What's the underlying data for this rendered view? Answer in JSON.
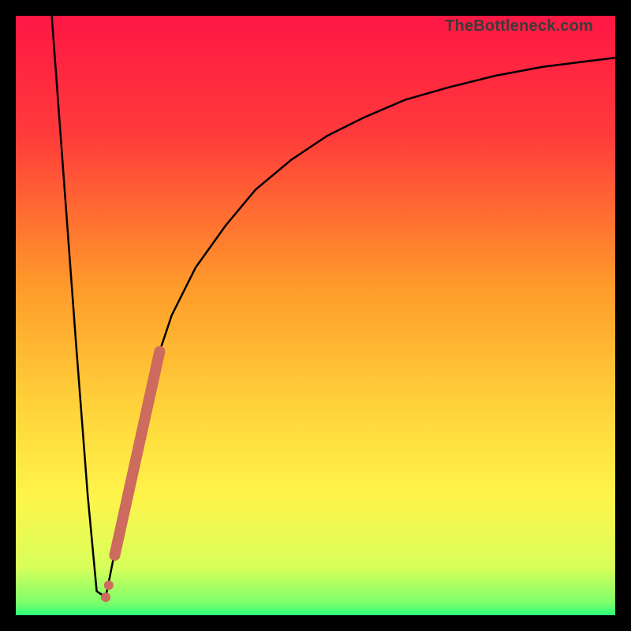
{
  "watermark": "TheBottleneck.com",
  "gradient_stops": [
    {
      "pct": 0,
      "color": "#ff1744"
    },
    {
      "pct": 20,
      "color": "#ff3b3b"
    },
    {
      "pct": 45,
      "color": "#ff9a2a"
    },
    {
      "pct": 65,
      "color": "#ffd23a"
    },
    {
      "pct": 80,
      "color": "#fff44a"
    },
    {
      "pct": 92,
      "color": "#d8ff5a"
    },
    {
      "pct": 98,
      "color": "#7bff6b"
    },
    {
      "pct": 100,
      "color": "#2bfc7a"
    }
  ],
  "chart_data": {
    "type": "line",
    "title": "",
    "xlabel": "",
    "ylabel": "",
    "xlim": [
      0,
      100
    ],
    "ylim": [
      0,
      100
    ],
    "series": [
      {
        "name": "bottleneck-curve",
        "x": [
          6,
          8,
          10,
          12,
          13.5,
          15,
          17,
          20,
          23,
          26,
          30,
          35,
          40,
          46,
          52,
          58,
          65,
          72,
          80,
          88,
          96,
          100
        ],
        "y": [
          100,
          73,
          46,
          20,
          4,
          3,
          13,
          29,
          41,
          50,
          58,
          65,
          71,
          76,
          80,
          83,
          86,
          88,
          90,
          91.5,
          92.5,
          93
        ]
      }
    ],
    "overlay_segment": {
      "name": "highlighted-range",
      "x1": 16.5,
      "y1": 10,
      "x2": 24,
      "y2": 44
    },
    "overlay_dots": [
      {
        "x": 15.5,
        "y": 5
      },
      {
        "x": 15.0,
        "y": 3
      }
    ]
  }
}
